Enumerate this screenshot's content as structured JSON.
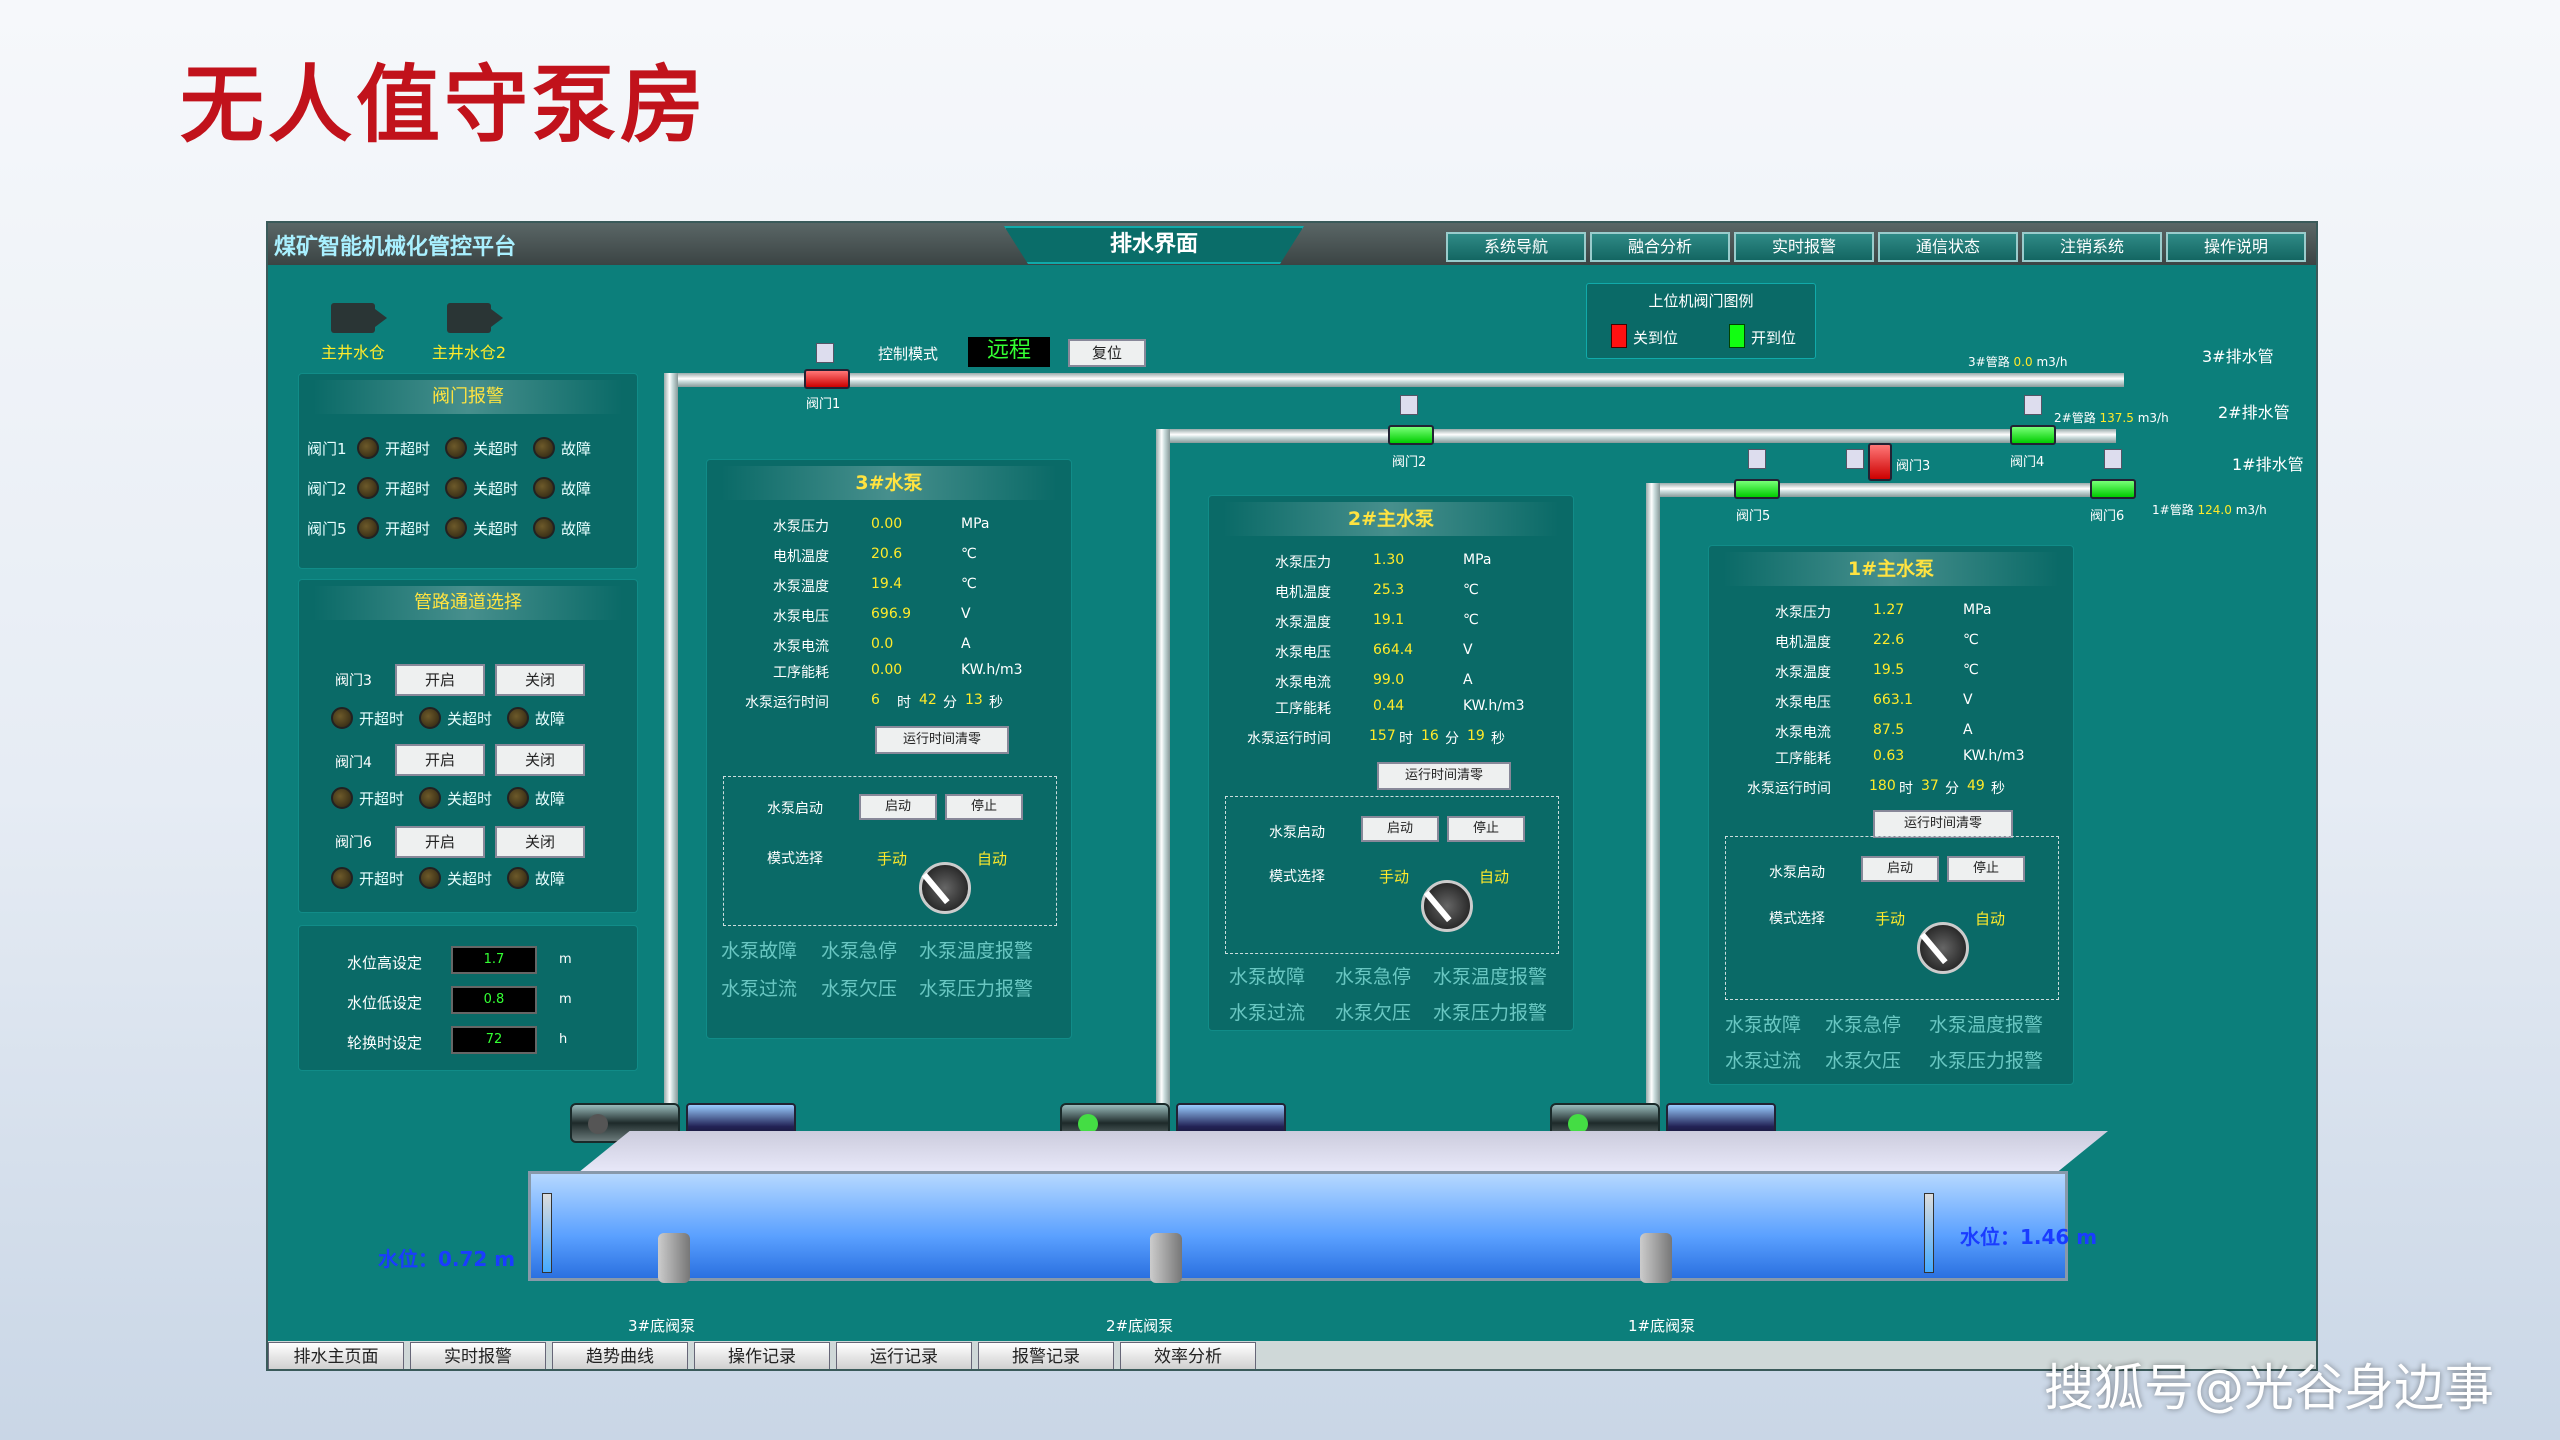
{
  "slide_title": "无人值守泵房",
  "watermark": "搜狐号@光谷身边事",
  "platform_title": "煤矿智能机械化管控平台",
  "center_tab": "排水界面",
  "nav": [
    "系统导航",
    "融合分析",
    "实时报警",
    "通信状态",
    "注销系统",
    "操作说明"
  ],
  "cameras": [
    "主井水仓",
    "主井水仓2"
  ],
  "legend": {
    "title": "上位机阀门图例",
    "closed": "关到位",
    "open": "开到位"
  },
  "control": {
    "label": "控制模式",
    "mode": "远程",
    "reset": "复位"
  },
  "valve_alarm": {
    "title": "阀门报警",
    "rows": [
      {
        "name": "阀门1",
        "a": "开超时",
        "b": "关超时",
        "c": "故障"
      },
      {
        "name": "阀门2",
        "a": "开超时",
        "b": "关超时",
        "c": "故障"
      },
      {
        "name": "阀门5",
        "a": "开超时",
        "b": "关超时",
        "c": "故障"
      }
    ]
  },
  "pipe_select": {
    "title": "管路通道选择",
    "rows": [
      {
        "name": "阀门3",
        "open": "开启",
        "close": "关闭",
        "a": "开超时",
        "b": "关超时",
        "c": "故障"
      },
      {
        "name": "阀门4",
        "open": "开启",
        "close": "关闭",
        "a": "开超时",
        "b": "关超时",
        "c": "故障"
      },
      {
        "name": "阀门6",
        "open": "开启",
        "close": "关闭",
        "a": "开超时",
        "b": "关超时",
        "c": "故障"
      }
    ]
  },
  "settings": [
    {
      "label": "水位高设定",
      "value": "1.7",
      "unit": "m"
    },
    {
      "label": "水位低设定",
      "value": "0.8",
      "unit": "m"
    },
    {
      "label": "轮换时设定",
      "value": "72",
      "unit": "h"
    }
  ],
  "pipes": [
    {
      "label": "3#排水管",
      "flow_label": "3#管路",
      "flow": "0.0",
      "unit": "m3/h"
    },
    {
      "label": "2#排水管",
      "flow_label": "2#管路",
      "flow": "137.5",
      "unit": "m3/h"
    },
    {
      "label": "1#排水管",
      "flow_label": "1#管路",
      "flow": "124.0",
      "unit": "m3/h"
    }
  ],
  "valves": [
    "阀门1",
    "阀门2",
    "阀门3",
    "阀门4",
    "阀门5",
    "阀门6"
  ],
  "pumps": [
    {
      "title": "3#水泵",
      "pressure": "0.00",
      "motor_temp": "20.6",
      "pump_temp": "19.4",
      "voltage": "696.9",
      "current": "0.0",
      "energy": "0.00",
      "run_h": "6",
      "run_m": "42",
      "run_s": "13"
    },
    {
      "title": "2#主水泵",
      "pressure": "1.30",
      "motor_temp": "25.3",
      "pump_temp": "19.1",
      "voltage": "664.4",
      "current": "99.0",
      "energy": "0.44",
      "run_h": "157",
      "run_m": "16",
      "run_s": "19"
    },
    {
      "title": "1#主水泵",
      "pressure": "1.27",
      "motor_temp": "22.6",
      "pump_temp": "19.5",
      "voltage": "663.1",
      "current": "87.5",
      "energy": "0.63",
      "run_h": "180",
      "run_m": "37",
      "run_s": "49"
    }
  ],
  "pump_labels": {
    "pressure": "水泵压力",
    "motor_temp": "电机温度",
    "pump_temp": "水泵温度",
    "voltage": "水泵电压",
    "current": "水泵电流",
    "energy": "工序能耗",
    "runtime": "水泵运行时间",
    "u_pressure": "MPa",
    "u_temp": "℃",
    "u_voltage": "V",
    "u_current": "A",
    "u_energy": "KW.h/m3",
    "hour": "时",
    "minute": "分",
    "second": "秒",
    "clear": "运行时间清零",
    "start_label": "水泵启动",
    "start": "启动",
    "stop": "停止",
    "mode_label": "模式选择",
    "manual": "手动",
    "auto": "自动",
    "alarms": [
      "水泵故障",
      "水泵急停",
      "水泵温度报警",
      "水泵过流",
      "水泵欠压",
      "水泵压力报警"
    ]
  },
  "water_left": "水位：0.72 m",
  "water_right": "水位：1.46 m",
  "bottom_valves": [
    "3#底阀泵",
    "2#底阀泵",
    "1#底阀泵"
  ],
  "bottom_nav": [
    "排水主页面",
    "实时报警",
    "趋势曲线",
    "操作记录",
    "运行记录",
    "报警记录",
    "效率分析"
  ]
}
